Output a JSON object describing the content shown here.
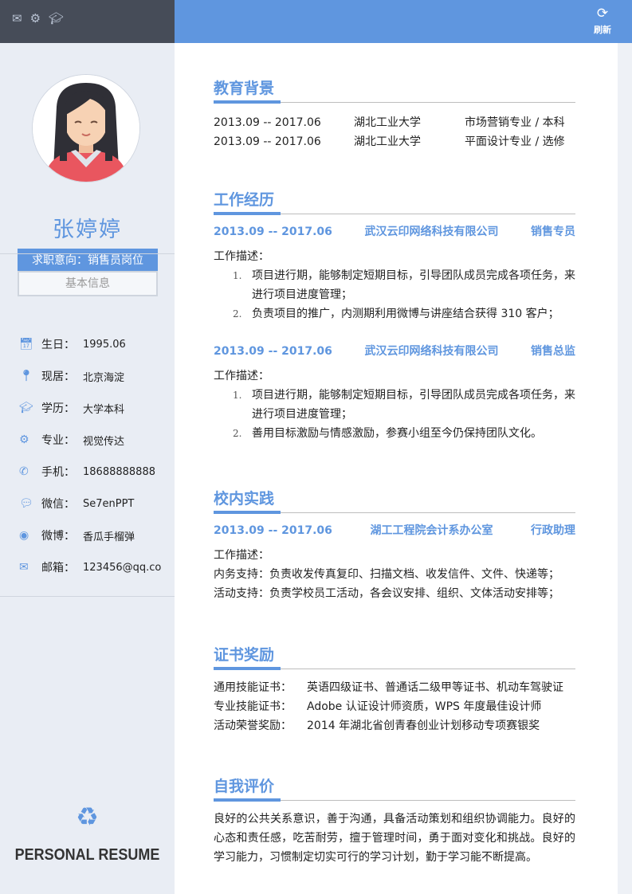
{
  "topbar": {
    "icons": [
      "mail-icon",
      "gear-icon",
      "graduation-cap-icon"
    ],
    "refresh_label": "刷新"
  },
  "profile": {
    "name": "张婷婷",
    "intent": "求职意向：销售员岗位",
    "basic_info_label": "基本信息"
  },
  "info": [
    {
      "icon": "calendar-icon",
      "label": "生日：",
      "value": "1995.06"
    },
    {
      "icon": "location-icon",
      "label": "现居：",
      "value": "北京海淀"
    },
    {
      "icon": "graduation-cap-icon",
      "label": "学历：",
      "value": "大学本科"
    },
    {
      "icon": "gear-icon",
      "label": "专业：",
      "value": "视觉传达"
    },
    {
      "icon": "phone-icon",
      "label": "手机：",
      "value": "18688888888"
    },
    {
      "icon": "wechat-icon",
      "label": "微信：",
      "value": "Se7enPPT"
    },
    {
      "icon": "weibo-icon",
      "label": "微博：",
      "value": "香瓜手榴弹"
    },
    {
      "icon": "mail-icon",
      "label": "邮箱：",
      "value": "123456@qq.co"
    }
  ],
  "footer_label": "PERSONAL RESUME",
  "education": {
    "title": "教育背景",
    "rows": [
      {
        "date": "2013.09 -- 2017.06",
        "school": "湖北工业大学",
        "major": "市场营销专业 / 本科"
      },
      {
        "date": "2013.09 -- 2017.06",
        "school": "湖北工业大学",
        "major": "平面设计专业 / 选修"
      }
    ]
  },
  "work": {
    "title": "工作经历",
    "jobs": [
      {
        "date": "2013.09 -- 2017.06",
        "company": "武汉云印网络科技有限公司",
        "role": "销售专员",
        "desc_label": "工作描述：",
        "items": [
          "项目进行期，能够制定短期目标，引导团队成员完成各项任务，来进行项目进度管理；",
          "负责项目的推广，内测期利用微博与讲座结合获得 310 客户；"
        ]
      },
      {
        "date": "2013.09 -- 2017.06",
        "company": "武汉云印网络科技有限公司",
        "role": "销售总监",
        "desc_label": "工作描述：",
        "items": [
          "项目进行期，能够制定短期目标，引导团队成员完成各项任务，来进行项目进度管理；",
          "善用目标激励与情感激励，参赛小组至今仍保持团队文化。"
        ]
      }
    ]
  },
  "campus": {
    "title": "校内实践",
    "date": "2013.09 -- 2017.06",
    "org": "湖工工程院会计系办公室",
    "role": "行政助理",
    "desc_label": "工作描述：",
    "lines": [
      "内务支持：负责收发传真复印、扫描文档、收发信件、文件、快递等；",
      "活动支持：负责学校员工活动，各会议安排、组织、文体活动安排等；"
    ]
  },
  "certs": {
    "title": "证书奖励",
    "rows": [
      {
        "label": "通用技能证书：",
        "value": "英语四级证书、普通话二级甲等证书、机动车驾驶证"
      },
      {
        "label": "专业技能证书：",
        "value": "Adobe 认证设计师资质，WPS 年度最佳设计师"
      },
      {
        "label": "活动荣誉奖励：",
        "value": "2014 年湖北省创青春创业计划移动专项赛银奖"
      }
    ]
  },
  "self": {
    "title": "自我评价",
    "text": "良好的公共关系意识，善于沟通，具备活动策划和组织协调能力。良好的心态和责任感，吃苦耐劳，擅于管理时间，勇于面对变化和挑战。良好的学习能力，习惯制定切实可行的学习计划，勤于学习能不断提高。"
  }
}
